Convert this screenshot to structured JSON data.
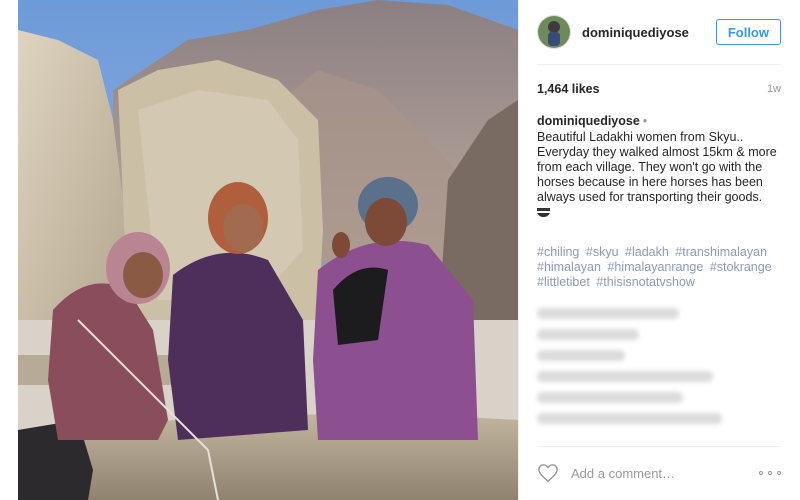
{
  "post": {
    "username": "dominiquediyose",
    "follow_label": "Follow",
    "likes": "1,464 likes",
    "age": "1w",
    "caption_user": "dominiquediyose",
    "caption_separator": "•",
    "caption_text": "Beautiful Ladakhi women from Skyu.. Everyday they walked almost 15km & more from each village. They won't go with the horses because in here horses has been always used for transporting their goods.",
    "hashtags": [
      "#chiling",
      "#skyu",
      "#ladakh",
      "#transhimalayan",
      "#himalayan",
      "#himalayanrange",
      "#stokrange",
      "#littletibet",
      "#thisisnotatvshow"
    ],
    "comment_placeholder": "Add a comment…"
  },
  "icons": {
    "like": "heart-outline-icon",
    "more": "more-options-icon",
    "avatar": "user-avatar"
  },
  "colors": {
    "follow": "#3897f0",
    "hashtag": "#8b9bb6",
    "text": "#262626",
    "muted": "#999999"
  }
}
